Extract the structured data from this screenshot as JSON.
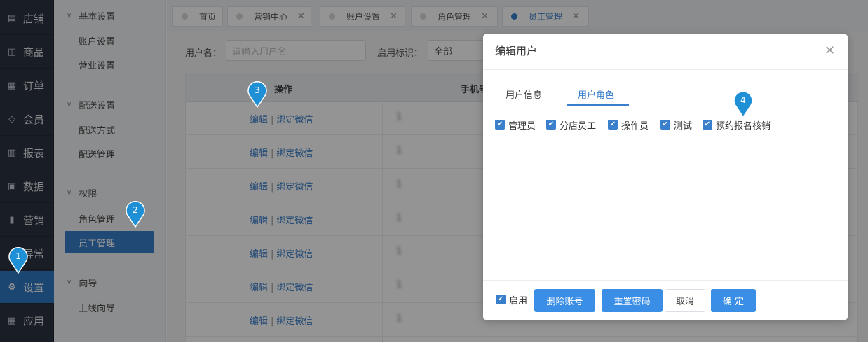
{
  "nav": {
    "items": [
      {
        "label": "店铺",
        "icon": "store-icon"
      },
      {
        "label": "商品",
        "icon": "gift-icon"
      },
      {
        "label": "订单",
        "icon": "order-icon"
      },
      {
        "label": "会员",
        "icon": "member-icon"
      },
      {
        "label": "报表",
        "icon": "report-icon"
      },
      {
        "label": "数据",
        "icon": "data-icon"
      },
      {
        "label": "营销",
        "icon": "marketing-icon"
      },
      {
        "label": "异常",
        "icon": "alert-icon"
      },
      {
        "label": "设置",
        "icon": "gear-icon"
      },
      {
        "label": "应用",
        "icon": "apps-icon"
      }
    ]
  },
  "submenu": {
    "groups": [
      {
        "label": "基本设置",
        "items": [
          "账户设置",
          "营业设置"
        ]
      },
      {
        "label": "配送设置",
        "items": [
          "配送方式",
          "配送管理"
        ]
      },
      {
        "label": "权限",
        "items": [
          "角色管理",
          "员工管理"
        ]
      },
      {
        "label": "向导",
        "items": [
          "上线向导"
        ]
      }
    ]
  },
  "tabs": [
    "首页",
    "营销中心",
    "账户设置",
    "角色管理",
    "员工管理"
  ],
  "filter": {
    "username_label": "用户名：",
    "username_placeholder": "请输入用户名",
    "status_label": "启用标识：",
    "status_value": "全部"
  },
  "table": {
    "headers": [
      "操作",
      "手机号"
    ],
    "op_edit": "编辑",
    "op_sep": "|",
    "op_bind": "绑定微信",
    "rows": [
      "1",
      "1",
      "1",
      "1",
      "1",
      "1",
      "1"
    ]
  },
  "dialog": {
    "title": "编辑用户",
    "tabs": [
      "用户信息",
      "用户角色"
    ],
    "roles": [
      "管理员",
      "分店员工",
      "操作员",
      "测试",
      "预约报名核销"
    ],
    "enable_label": "启用",
    "buttons": {
      "delete": "删除账号",
      "reset": "重置密码",
      "cancel": "取消",
      "confirm": "确 定"
    }
  },
  "markers": [
    "1",
    "2",
    "3",
    "4"
  ],
  "colors": {
    "accent": "#3a7fcb",
    "sidebar": "#2c3341",
    "marker": "#1f8fd6"
  }
}
